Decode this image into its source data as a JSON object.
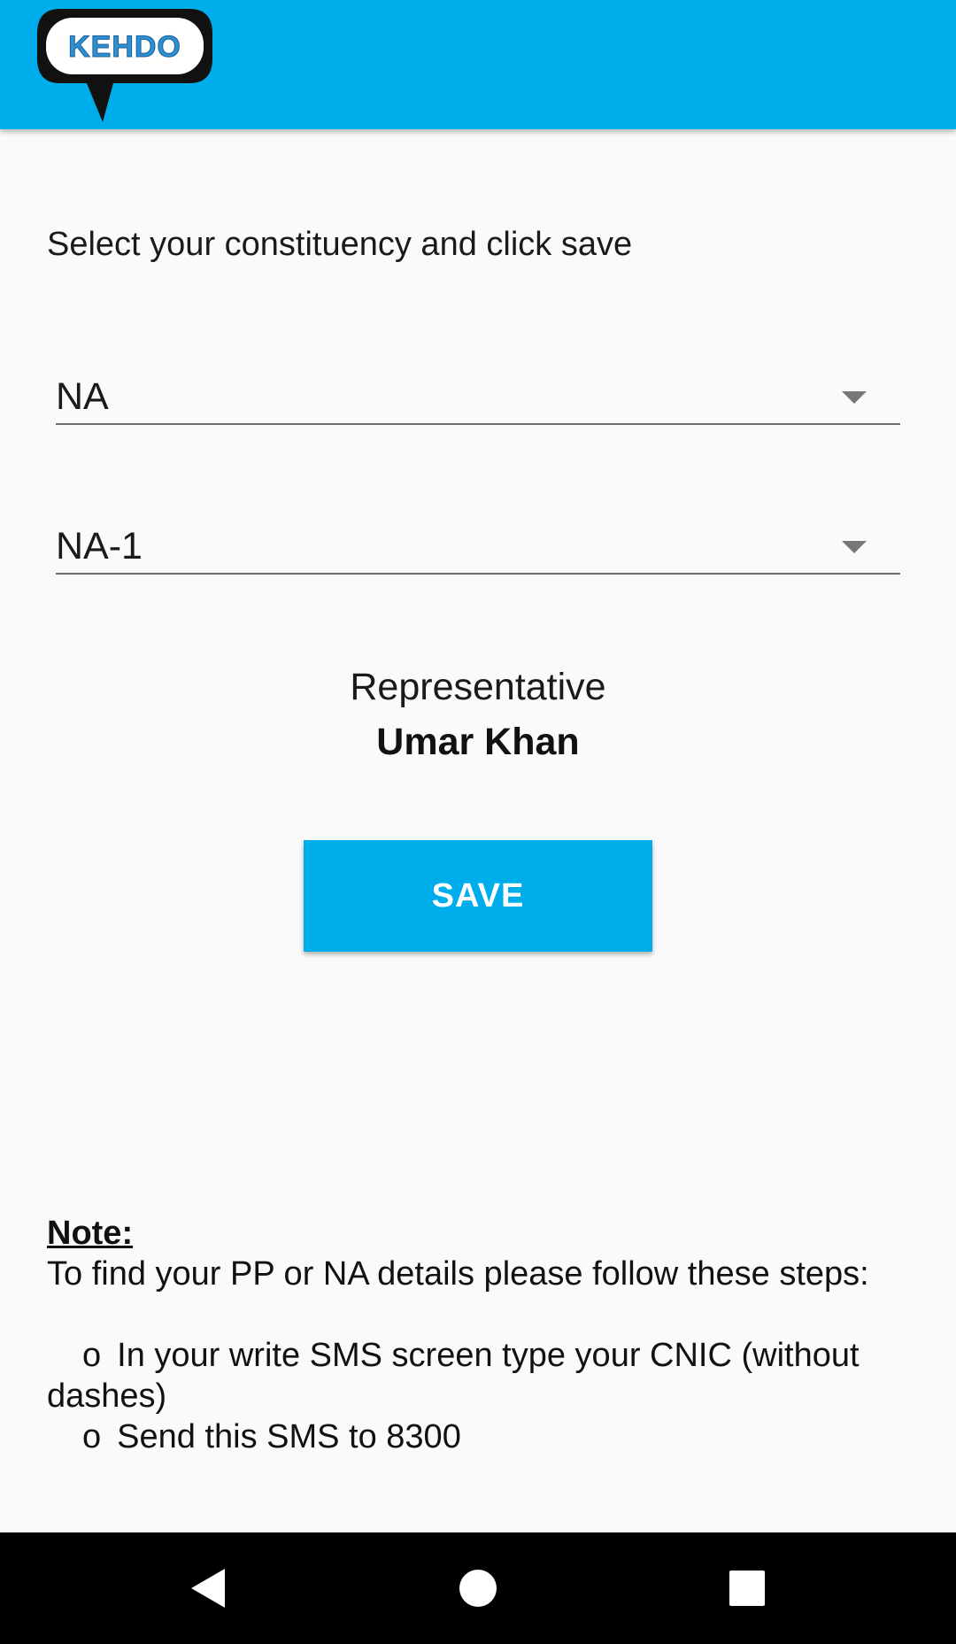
{
  "app": {
    "logo_text": "KEHDO",
    "colors": {
      "primary": "#00adeb",
      "nav_bar": "#000000",
      "background": "#fafafa"
    }
  },
  "instruction": "Select your constituency and click save",
  "spinners": [
    {
      "value": "NA",
      "icon": "dropdown-caret-icon"
    },
    {
      "value": "NA-1",
      "icon": "dropdown-caret-icon"
    }
  ],
  "representative": {
    "label": "Representative",
    "name": "Umar Khan"
  },
  "save_label": "SAVE",
  "note": {
    "title": "Note:",
    "intro": "To find your PP or NA details please follow these steps:",
    "steps": [
      {
        "bullet": "o",
        "text": "In your write SMS screen type your CNIC (without dashes)"
      },
      {
        "bullet": "o",
        "text": "Send this SMS to 8300"
      }
    ]
  },
  "navbar": {
    "back_icon": "back-triangle-icon",
    "home_icon": "home-circle-icon",
    "recent_icon": "recents-square-icon"
  }
}
